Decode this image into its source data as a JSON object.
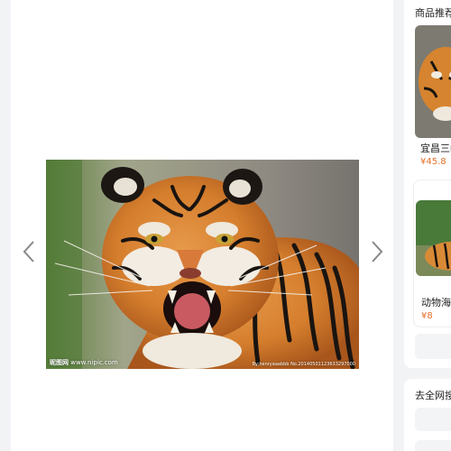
{
  "sidebar": {
    "title": "商品推荐",
    "products": [
      {
        "name": "宜昌三峡",
        "price": "¥45.8"
      },
      {
        "name": "动物海报",
        "price": "¥8"
      }
    ]
  },
  "search": {
    "title": "去全网搜"
  },
  "image": {
    "watermark_left_brand": "昵图网",
    "watermark_left_url": "www.nipic.com",
    "watermark_right": "By:henryaaabbb  No.20140501123633297000"
  },
  "icons": {
    "prev": "chevron-left-icon",
    "next": "chevron-right-icon"
  },
  "colors": {
    "price": "#e4712a",
    "background": "#f2f3f5"
  }
}
